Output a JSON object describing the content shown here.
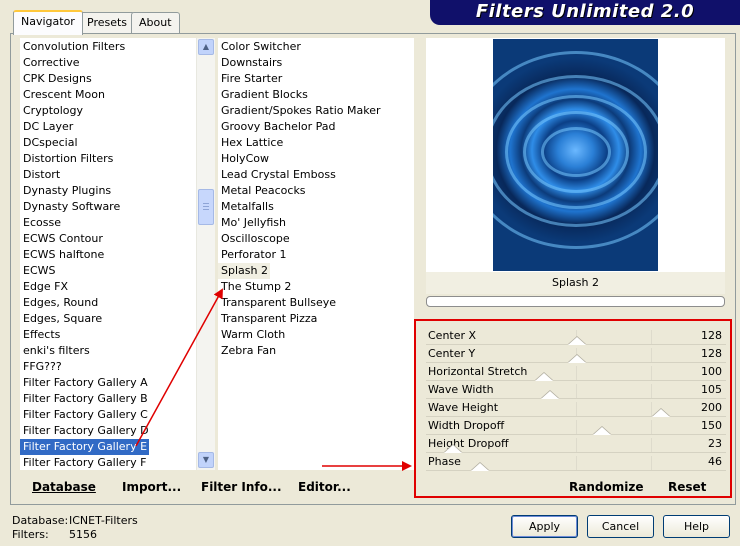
{
  "app_title": "Filters Unlimited 2.0",
  "tabs": [
    {
      "label": "Navigator",
      "active": true
    },
    {
      "label": "Presets",
      "active": false
    },
    {
      "label": "About",
      "active": false
    }
  ],
  "categories": [
    {
      "label": "Convolution Filters"
    },
    {
      "label": "Corrective"
    },
    {
      "label": "CPK Designs"
    },
    {
      "label": "Crescent Moon"
    },
    {
      "label": "Cryptology"
    },
    {
      "label": "DC Layer"
    },
    {
      "label": "DCspecial"
    },
    {
      "label": "Distortion Filters"
    },
    {
      "label": "Distort"
    },
    {
      "label": "Dynasty Plugins"
    },
    {
      "label": "Dynasty Software"
    },
    {
      "label": "Ecosse"
    },
    {
      "label": "ECWS Contour"
    },
    {
      "label": "ECWS halftone"
    },
    {
      "label": "ECWS"
    },
    {
      "label": "Edge FX"
    },
    {
      "label": "Edges, Round"
    },
    {
      "label": "Edges, Square"
    },
    {
      "label": "Effects"
    },
    {
      "label": "enki's filters"
    },
    {
      "label": "FFG???"
    },
    {
      "label": "Filter Factory Gallery A"
    },
    {
      "label": "Filter Factory Gallery B"
    },
    {
      "label": "Filter Factory Gallery C"
    },
    {
      "label": "Filter Factory Gallery D"
    },
    {
      "label": "Filter Factory Gallery E",
      "selected": true
    },
    {
      "label": "Filter Factory Gallery F"
    }
  ],
  "filters": [
    {
      "label": "Color Switcher"
    },
    {
      "label": "Downstairs"
    },
    {
      "label": "Fire Starter"
    },
    {
      "label": "Gradient Blocks"
    },
    {
      "label": "Gradient/Spokes Ratio Maker"
    },
    {
      "label": "Groovy Bachelor Pad"
    },
    {
      "label": "Hex Lattice"
    },
    {
      "label": "HolyCow"
    },
    {
      "label": "Lead Crystal Emboss"
    },
    {
      "label": "Metal Peacocks"
    },
    {
      "label": "Metalfalls"
    },
    {
      "label": "Mo' Jellyfish"
    },
    {
      "label": "Oscilloscope"
    },
    {
      "label": "Perforator 1"
    },
    {
      "label": "Splash 2",
      "selected": true
    },
    {
      "label": "The Stump 2"
    },
    {
      "label": "Transparent Bullseye"
    },
    {
      "label": "Transparent Pizza"
    },
    {
      "label": "Warm Cloth"
    },
    {
      "label": "Zebra Fan"
    }
  ],
  "preview": {
    "caption": "Splash 2"
  },
  "parameters": [
    {
      "label": "Center X",
      "value": "128",
      "level": 128
    },
    {
      "label": "Center Y",
      "value": "128",
      "level": 128
    },
    {
      "label": "Horizontal Stretch",
      "value": "100",
      "level": 100
    },
    {
      "label": "Wave Width",
      "value": "105",
      "level": 105
    },
    {
      "label": "Wave Height",
      "value": "200",
      "level": 200
    },
    {
      "label": "Width Dropoff",
      "value": "150",
      "level": 150
    },
    {
      "label": "Height Dropoff",
      "value": "23",
      "level": 23
    },
    {
      "label": "Phase",
      "value": "46",
      "level": 46
    }
  ],
  "actions": {
    "database": "Database",
    "import": "Import...",
    "filter_info": "Filter Info...",
    "editor": "Editor...",
    "randomize": "Randomize",
    "reset": "Reset"
  },
  "status": {
    "database_label": "Database:",
    "database_value": "ICNET-Filters",
    "filters_label": "Filters:",
    "filters_value": "5156"
  },
  "buttons": {
    "apply": "Apply",
    "cancel": "Cancel",
    "help": "Help"
  },
  "colors": {
    "selection": "#316ac5",
    "annotation": "#e00000",
    "banner": "#10106a"
  }
}
